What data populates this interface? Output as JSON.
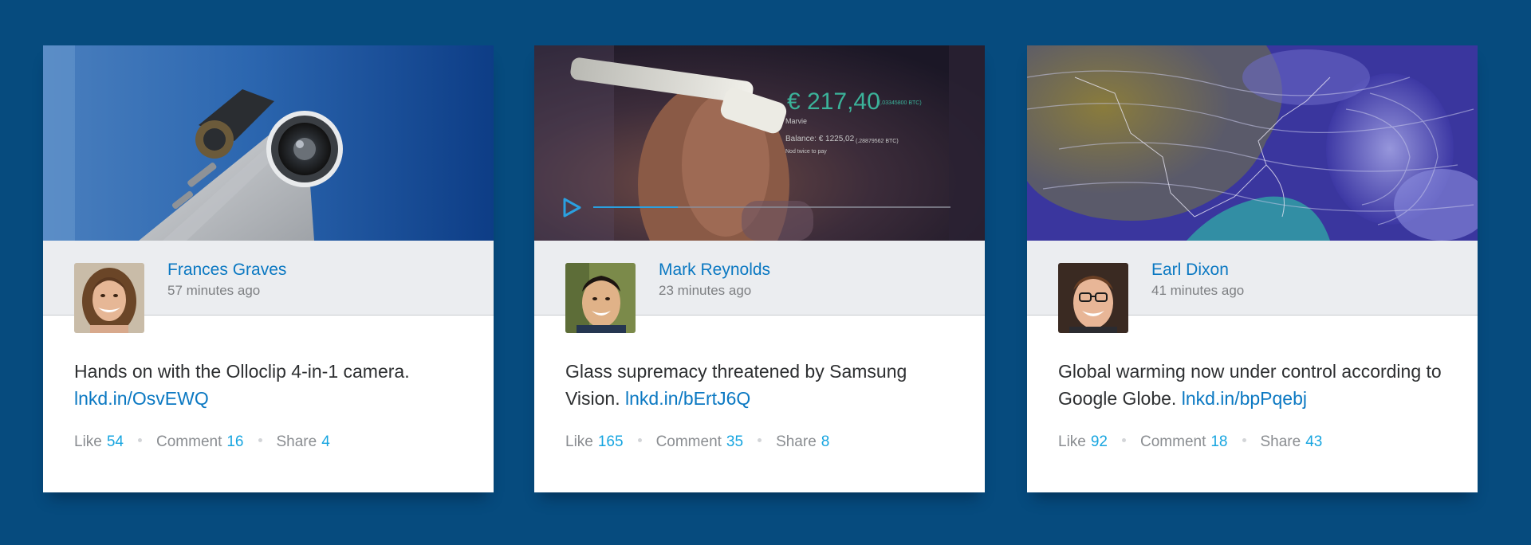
{
  "cards": [
    {
      "author": "Frances Graves",
      "time": "57 minutes ago",
      "text": "Hands on with the Olloclip 4-in-1 camera.",
      "link": "lnkd.in/OsvEWQ",
      "like_label": "Like",
      "like_count": "54",
      "comment_label": "Comment",
      "comment_count": "16",
      "share_label": "Share",
      "share_count": "4"
    },
    {
      "author": "Mark Reynolds",
      "time": "23 minutes ago",
      "text": "Glass supremacy threatened by Samsung Vision.",
      "link": "lnkd.in/bErtJ6Q",
      "like_label": "Like",
      "like_count": "165",
      "comment_label": "Comment",
      "comment_count": "35",
      "share_label": "Share",
      "share_count": "8",
      "hud": {
        "price": "€ 217,40",
        "btc": "(.03345800 BTC)",
        "name": "Marvie",
        "balance": "Balance: € 1225,02",
        "balance_btc": "(.28879562 BTC)",
        "nod": "Nod twice to pay"
      }
    },
    {
      "author": "Earl Dixon",
      "time": "41 minutes ago",
      "text": "Global warming now under control according to Google Globe.",
      "link": "lnkd.in/bpPqebj",
      "like_label": "Like",
      "like_count": "92",
      "comment_label": "Comment",
      "comment_count": "18",
      "share_label": "Share",
      "share_count": "43"
    }
  ],
  "colors": {
    "background": "#064b7e",
    "link": "#0a78c2",
    "count": "#17a5e0"
  }
}
